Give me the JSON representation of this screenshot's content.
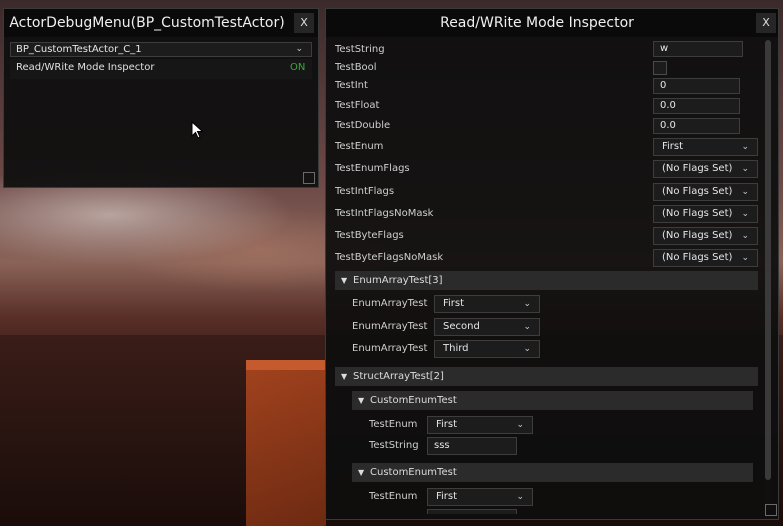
{
  "debug_menu": {
    "title": "ActorDebugMenu(BP_CustomTestActor)",
    "close_label": "X",
    "actor_select": "BP_CustomTestActor_C_1",
    "items": [
      {
        "label": "Read/WRite Mode Inspector",
        "state": "ON"
      }
    ]
  },
  "inspector": {
    "title": "Read/WRite Mode Inspector",
    "close_label": "X",
    "props": {
      "test_string": {
        "label": "TestString",
        "value": "w"
      },
      "test_bool": {
        "label": "TestBool",
        "checked": false
      },
      "test_int": {
        "label": "TestInt",
        "value": "0"
      },
      "test_float": {
        "label": "TestFloat",
        "value": "0.0"
      },
      "test_double": {
        "label": "TestDouble",
        "value": "0.0"
      },
      "test_enum": {
        "label": "TestEnum",
        "value": "First"
      },
      "test_enum_flags": {
        "label": "TestEnumFlags",
        "value": "(No Flags Set)"
      },
      "test_int_flags": {
        "label": "TestIntFlags",
        "value": "(No Flags Set)"
      },
      "test_int_flags_no_mask": {
        "label": "TestIntFlagsNoMask",
        "value": "(No Flags Set)"
      },
      "test_byte_flags": {
        "label": "TestByteFlags",
        "value": "(No Flags Set)"
      },
      "test_byte_flags_no_mask": {
        "label": "TestByteFlagsNoMask",
        "value": "(No Flags Set)"
      }
    },
    "enum_array": {
      "header": "EnumArrayTest[3]",
      "items": [
        {
          "label": "EnumArrayTest",
          "value": "First"
        },
        {
          "label": "EnumArrayTest",
          "value": "Second"
        },
        {
          "label": "EnumArrayTest",
          "value": "Third"
        }
      ]
    },
    "struct_array": {
      "header": "StructArrayTest[2]",
      "structs": [
        {
          "header": "CustomEnumTest",
          "enum_label": "TestEnum",
          "enum_value": "First",
          "string_label": "TestString",
          "string_value": "sss"
        },
        {
          "header": "CustomEnumTest",
          "enum_label": "TestEnum",
          "enum_value": "First"
        }
      ]
    }
  },
  "icons": {
    "chevron": "chevron-down-icon",
    "collapse": "triangle-down-icon",
    "cursor": "mouse-cursor-icon"
  },
  "colors": {
    "on_state": "#3aa83a",
    "panel_bg": "#0e0e0e"
  }
}
